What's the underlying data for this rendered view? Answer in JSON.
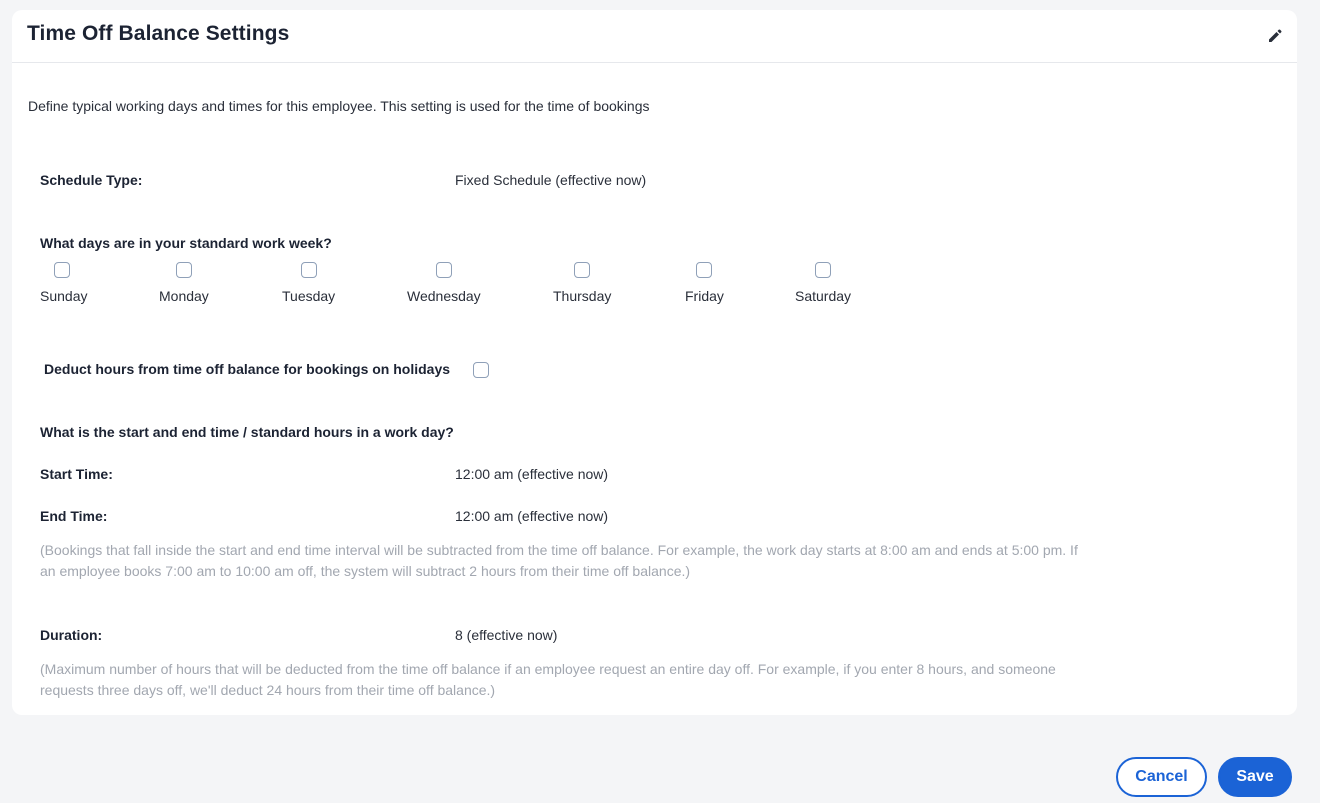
{
  "card": {
    "title": "Time Off Balance Settings",
    "edit_icon": "pencil-icon"
  },
  "intro": "Define typical working days and times for this employee. This setting is used for the time of bookings",
  "schedule_type": {
    "label": "Schedule Type:",
    "value": "Fixed Schedule (effective now)"
  },
  "work_week": {
    "question": "What days are in your standard work week?",
    "days": [
      {
        "label": "Sunday",
        "checked": false
      },
      {
        "label": "Monday",
        "checked": false
      },
      {
        "label": "Tuesday",
        "checked": false
      },
      {
        "label": "Wednesday",
        "checked": false
      },
      {
        "label": "Thursday",
        "checked": false
      },
      {
        "label": "Friday",
        "checked": false
      },
      {
        "label": "Saturday",
        "checked": false
      }
    ]
  },
  "holidays": {
    "label": "Deduct hours from time off balance for bookings on holidays",
    "checked": false
  },
  "work_day": {
    "question": "What is the start and end time / standard hours in a work day?",
    "start_label": "Start Time:",
    "start_value": "12:00 am (effective now)",
    "end_label": "End Time:",
    "end_value": "12:00 am (effective now)",
    "help": "(Bookings that fall inside the start and end time interval will be subtracted from the time off balance. For example, the work day starts at 8:00 am and ends at 5:00 pm. If an employee books 7:00 am to 10:00 am off, the system will subtract 2 hours from their time off balance.)"
  },
  "duration": {
    "label": "Duration:",
    "value": "8 (effective now)",
    "help": "(Maximum number of hours that will be deducted from the time off balance if an employee request an entire day off. For example, if you enter 8 hours, and someone requests three days off, we'll deduct 24 hours from their time off balance.)"
  },
  "actions": {
    "cancel_label": "Cancel",
    "save_label": "Save"
  },
  "colors": {
    "primary": "#1b63d6",
    "muted_text": "#a2a7b0",
    "background": "#f4f5f7"
  }
}
